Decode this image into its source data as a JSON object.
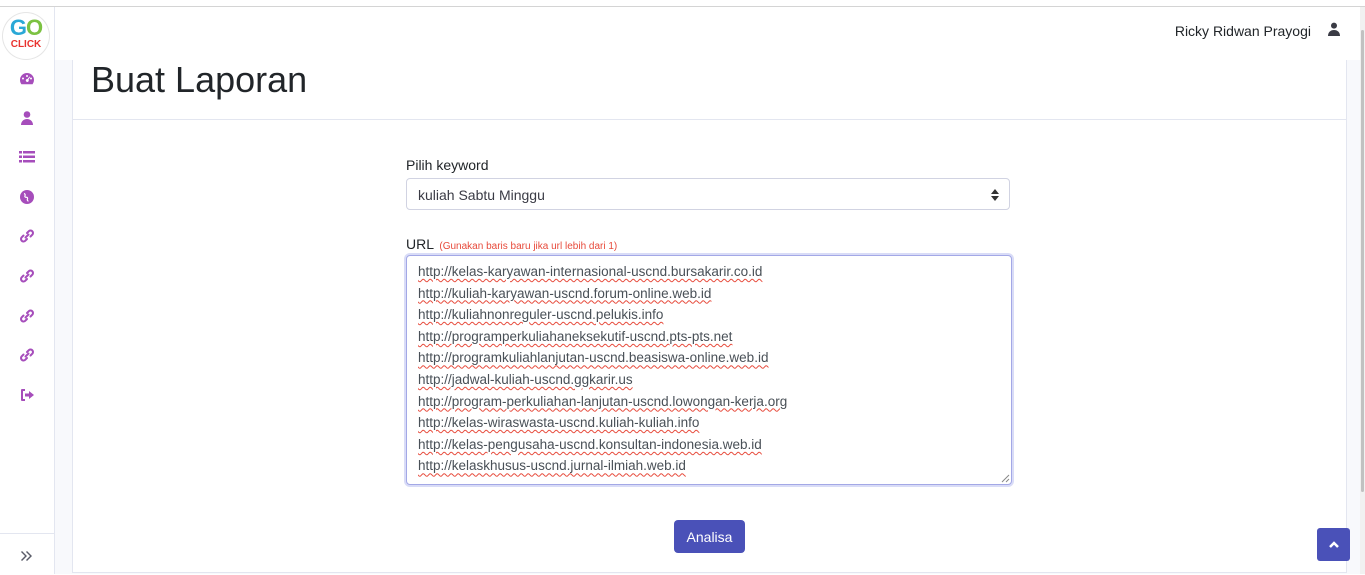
{
  "logo": {
    "go_g": "G",
    "go_o": "O",
    "click": "CLICK"
  },
  "sidebar": {
    "items": [
      {
        "icon": "dashboard-icon"
      },
      {
        "icon": "user-icon"
      },
      {
        "icon": "list-icon"
      },
      {
        "icon": "globe-icon"
      },
      {
        "icon": "link-icon"
      },
      {
        "icon": "link-icon"
      },
      {
        "icon": "link-icon"
      },
      {
        "icon": "link-icon"
      },
      {
        "icon": "logout-icon"
      }
    ],
    "toggle_icon": "angle-double-right-icon"
  },
  "header": {
    "username": "Ricky Ridwan Prayogi",
    "user_icon": "user-icon"
  },
  "main": {
    "title": "Buat Laporan",
    "keyword_label": "Pilih keyword",
    "keyword_selected": "kuliah Sabtu Minggu",
    "url_label": "URL",
    "url_hint": "(Gunakan baris baru jika url lebih dari 1)",
    "urls": [
      "http://kelas-karyawan-internasional-uscnd.bursakarir.co.id",
      "http://kuliah-karyawan-uscnd.forum-online.web.id",
      "http://kuliahnonreguler-uscnd.pelukis.info",
      "http://programperkuliahaneksekutif-uscnd.pts-pts.net",
      "http://programkuliahlanjutan-uscnd.beasiswa-online.web.id",
      "http://jadwal-kuliah-uscnd.ggkarir.us",
      "http://program-perkuliahan-lanjutan-uscnd.lowongan-kerja.org",
      "http://kelas-wiraswasta-uscnd.kuliah-kuliah.info",
      "http://kelas-pengusaha-uscnd.konsultan-indonesia.web.id",
      "http://kelaskhusus-uscnd.jurnal-ilmiah.web.id"
    ],
    "submit_label": "Analisa"
  },
  "colors": {
    "accent": "#4a51b8",
    "sidebar_icon": "#a64dbb",
    "hint": "#e74a3b"
  }
}
